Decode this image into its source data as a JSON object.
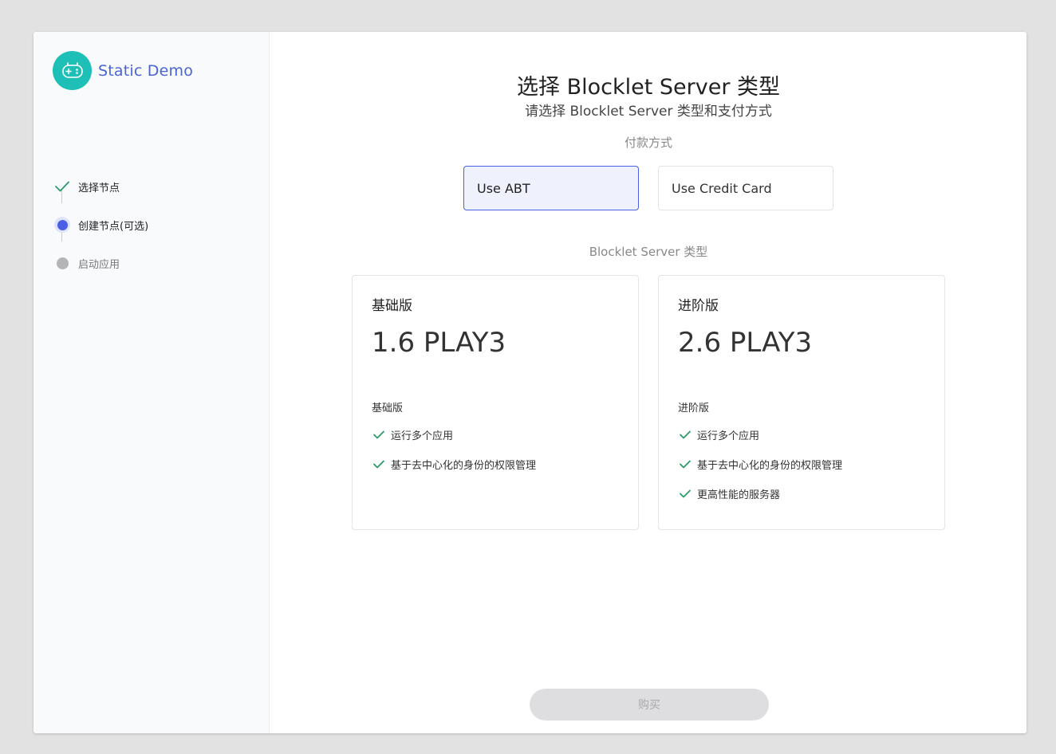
{
  "app": {
    "name": "Static Demo",
    "logo_icon": "gamepad-icon",
    "logo_color": "#1ebfb6",
    "accent": "#4b5fe6"
  },
  "steps": [
    {
      "label": "选择节点",
      "state": "done",
      "icon": "check-icon"
    },
    {
      "label": "创建节点(可选)",
      "state": "active",
      "icon": "active-dot-icon"
    },
    {
      "label": "启动应用",
      "state": "pending",
      "icon": "pending-dot-icon"
    }
  ],
  "main": {
    "title": "选择 Blocklet Server 类型",
    "subtitle": "请选择 Blocklet Server 类型和支付方式",
    "payment_label": "付款方式",
    "payment_options": [
      {
        "label": "Use ABT",
        "selected": true
      },
      {
        "label": "Use Credit Card",
        "selected": false
      }
    ],
    "type_label": "Blocklet Server 类型",
    "plans": [
      {
        "name": "基础版",
        "price": "1.6 PLAY3",
        "subtitle": "基础版",
        "features": [
          "运行多个应用",
          "基于去中心化的身份的权限管理"
        ]
      },
      {
        "name": "进阶版",
        "price": "2.6 PLAY3",
        "subtitle": "进阶版",
        "features": [
          "运行多个应用",
          "基于去中心化的身份的权限管理",
          "更高性能的服务器"
        ]
      }
    ],
    "buy_label": "购买"
  }
}
